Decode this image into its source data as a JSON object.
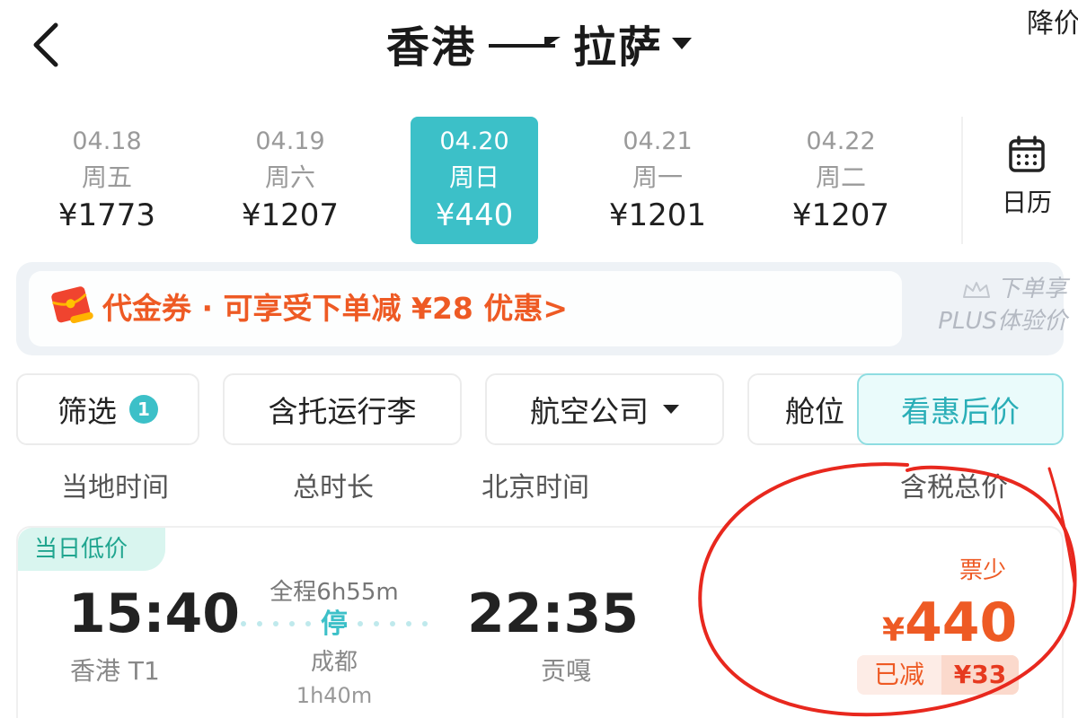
{
  "header": {
    "origin": "香港",
    "destination": "拉萨",
    "price_alert_label": "降价提醒"
  },
  "date_bar": {
    "dates": [
      {
        "date": "04.18",
        "weekday": "周五",
        "price": "¥1773"
      },
      {
        "date": "04.19",
        "weekday": "周六",
        "price": "¥1207"
      },
      {
        "date": "04.20",
        "weekday": "周日",
        "price": "¥440"
      },
      {
        "date": "04.21",
        "weekday": "周一",
        "price": "¥1201"
      },
      {
        "date": "04.22",
        "weekday": "周二",
        "price": "¥1207"
      }
    ],
    "selected_index": 2,
    "calendar_label": "日历",
    "accent_color": "#3cc0c8"
  },
  "promo": {
    "coupon_text": "代金券",
    "separator": " · ",
    "offer_text": "可享受下单减 ¥28 优惠>",
    "plus_line1": "下单享",
    "plus_line2": "PLUS体验价",
    "color": "#ee5a24"
  },
  "filters": {
    "filter_label": "筛选",
    "filter_count": "1",
    "baggage_label": "含托运行李",
    "airline_label": "航空公司",
    "cabin_label": "舱位",
    "discount_price_label": "看惠后价"
  },
  "columns": {
    "local_time": "当地时间",
    "duration": "总时长",
    "beijing_time": "北京时间",
    "total_price": "含税总价"
  },
  "flight": {
    "tag": "当日低价",
    "departure_time": "15:40",
    "departure_place": "香港 T1",
    "total_duration": "全程6h55m",
    "stop_label": "停",
    "stop_city": "成都",
    "stop_duration": "1h40m",
    "arrival_time": "22:35",
    "arrival_place": "贡嘎",
    "availability": "票少",
    "currency": "¥",
    "price": "440",
    "discount_label": "已减",
    "discount_value": "¥33"
  },
  "icons": [
    "back-icon",
    "caret-down-icon",
    "calendar-icon",
    "red-envelope-icon",
    "crown-icon"
  ]
}
